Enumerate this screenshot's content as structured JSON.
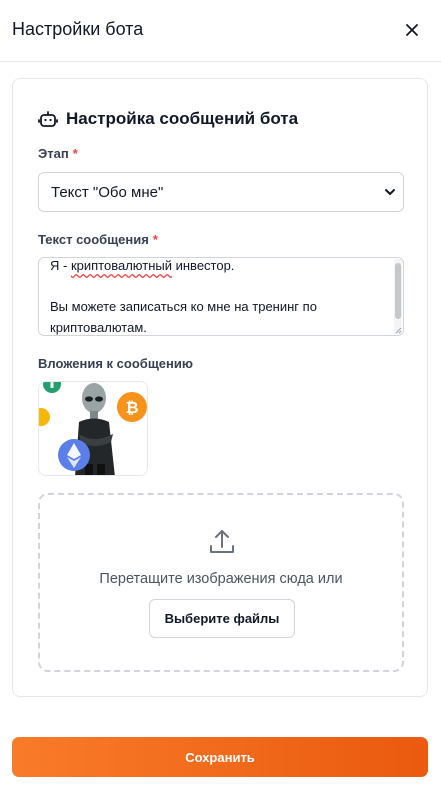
{
  "header": {
    "title": "Настройки бота",
    "close_icon": "close-icon"
  },
  "card": {
    "section_title": "Настройка сообщений бота",
    "section_icon": "bot-icon",
    "stage": {
      "label": "Этап",
      "required_mark": "*",
      "selected_value": "Текст \"Обо мне\""
    },
    "message": {
      "label": "Текст сообщения",
      "required_mark": "*",
      "line1_prefix": "Я - ",
      "line1_misspelled": "криптовалютный",
      "line1_suffix": " инвестор.",
      "rest": "\n\nВы можете записаться ко мне на тренинг по криптовалютам."
    },
    "attachments": {
      "label": "Вложения к сообщению"
    },
    "dropzone": {
      "icon": "upload-icon",
      "text": "Перетащите изображения сюда или",
      "button_label": "Выберите файлы"
    }
  },
  "footer": {
    "save_label": "Сохранить"
  },
  "colors": {
    "accent": "#f97316",
    "required": "#ef4444"
  }
}
